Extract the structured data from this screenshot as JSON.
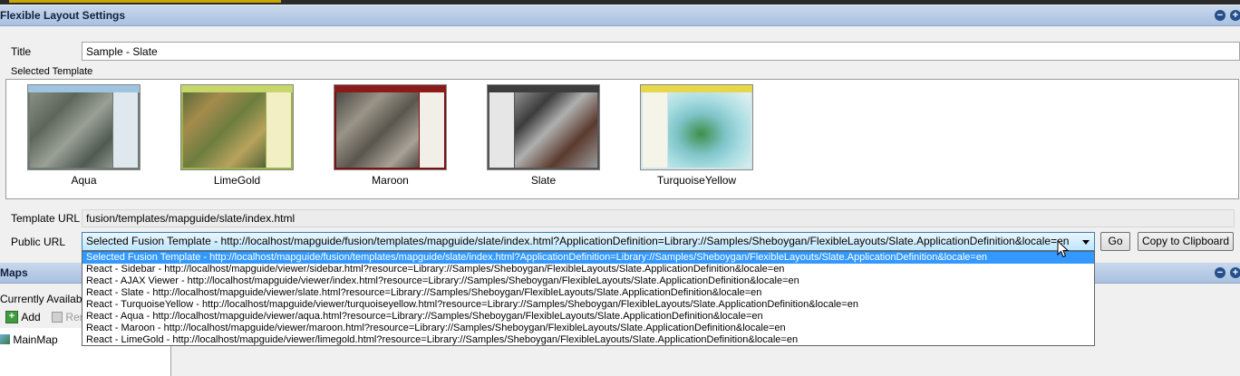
{
  "colors": {
    "header_bg": "#b8cce8",
    "selection": "#3399ff",
    "accent_icon": "#26508c"
  },
  "section1": {
    "title": "Flexible Layout Settings",
    "collapse_icon": "minus-circle-icon",
    "expand_icon": "plus-circle-icon"
  },
  "title_field": {
    "label": "Title",
    "value": "Sample - Slate"
  },
  "template": {
    "label": "Selected Template",
    "items": [
      {
        "name": "Aqua"
      },
      {
        "name": "LimeGold"
      },
      {
        "name": "Maroon"
      },
      {
        "name": "Slate"
      },
      {
        "name": "TurquoiseYellow"
      }
    ]
  },
  "template_url": {
    "label": "Template URL",
    "value": "fusion/templates/mapguide/slate/index.html"
  },
  "public_url": {
    "label": "Public URL",
    "selected": "Selected Fusion Template - http://localhost/mapguide/fusion/templates/mapguide/slate/index.html?ApplicationDefinition=Library://Samples/Sheboygan/FlexibleLayouts/Slate.ApplicationDefinition&locale=en",
    "go_button": "Go",
    "copy_button": "Copy to Clipboard",
    "options": [
      "Selected Fusion Template - http://localhost/mapguide/fusion/templates/mapguide/slate/index.html?ApplicationDefinition=Library://Samples/Sheboygan/FlexibleLayouts/Slate.ApplicationDefinition&locale=en",
      "React - Sidebar - http://localhost/mapguide/viewer/sidebar.html?resource=Library://Samples/Sheboygan/FlexibleLayouts/Slate.ApplicationDefinition&locale=en",
      "React - AJAX Viewer - http://localhost/mapguide/viewer/index.html?resource=Library://Samples/Sheboygan/FlexibleLayouts/Slate.ApplicationDefinition&locale=en",
      "React - Slate - http://localhost/mapguide/viewer/slate.html?resource=Library://Samples/Sheboygan/FlexibleLayouts/Slate.ApplicationDefinition&locale=en",
      "React - TurquoiseYellow - http://localhost/mapguide/viewer/turquoiseyellow.html?resource=Library://Samples/Sheboygan/FlexibleLayouts/Slate.ApplicationDefinition&locale=en",
      "React - Aqua - http://localhost/mapguide/viewer/aqua.html?resource=Library://Samples/Sheboygan/FlexibleLayouts/Slate.ApplicationDefinition&locale=en",
      "React - Maroon - http://localhost/mapguide/viewer/maroon.html?resource=Library://Samples/Sheboygan/FlexibleLayouts/Slate.ApplicationDefinition&locale=en",
      "React - LimeGold - http://localhost/mapguide/viewer/limegold.html?resource=Library://Samples/Sheboygan/FlexibleLayouts/Slate.ApplicationDefinition&locale=en"
    ]
  },
  "section2": {
    "title": "Maps",
    "collapse_icon": "minus-circle-icon",
    "expand_icon": "plus-circle-icon"
  },
  "maps": {
    "currently_available_label": "Currently Available",
    "add_button": "Add",
    "remove_button": "Rer",
    "tree_items": [
      {
        "label": "MainMap"
      }
    ]
  }
}
